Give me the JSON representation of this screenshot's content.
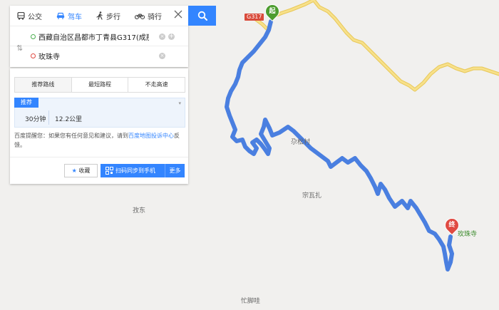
{
  "tabs": [
    {
      "label": "公交",
      "icon": "bus-icon",
      "active": false
    },
    {
      "label": "驾车",
      "icon": "car-icon",
      "active": true
    },
    {
      "label": "步行",
      "icon": "walk-icon",
      "active": false
    },
    {
      "label": "骑行",
      "icon": "bike-icon",
      "active": false
    }
  ],
  "route": {
    "from": "西藏自治区昌都市丁青县G317(成那",
    "to": "玫珠寺"
  },
  "route_options": [
    "推荐路线",
    "最短路程",
    "不走高速"
  ],
  "plan": {
    "tag": "推荐",
    "time": "30分钟",
    "distance": "12.2公里"
  },
  "notice": {
    "prefix": "百度提醒您：如果您有任何意见和建议，请到",
    "link": "百度地图投诉中心",
    "suffix": "反馈。"
  },
  "actions": {
    "favorite": "收藏",
    "send_to_phone": "扫码同步到手机",
    "more": "更多"
  },
  "map": {
    "road_shield": "G317",
    "start_marker": "起",
    "end_marker": "终",
    "destination_label": "玫珠寺",
    "places": [
      "尕松村",
      "宗瓦扎",
      "孜东",
      "忙脚哇"
    ],
    "colors": {
      "route": "#4a7fe0",
      "highway": "#f2d36b",
      "start": "#4c9c2e",
      "end": "#e04a42",
      "accent": "#3385ff"
    }
  }
}
